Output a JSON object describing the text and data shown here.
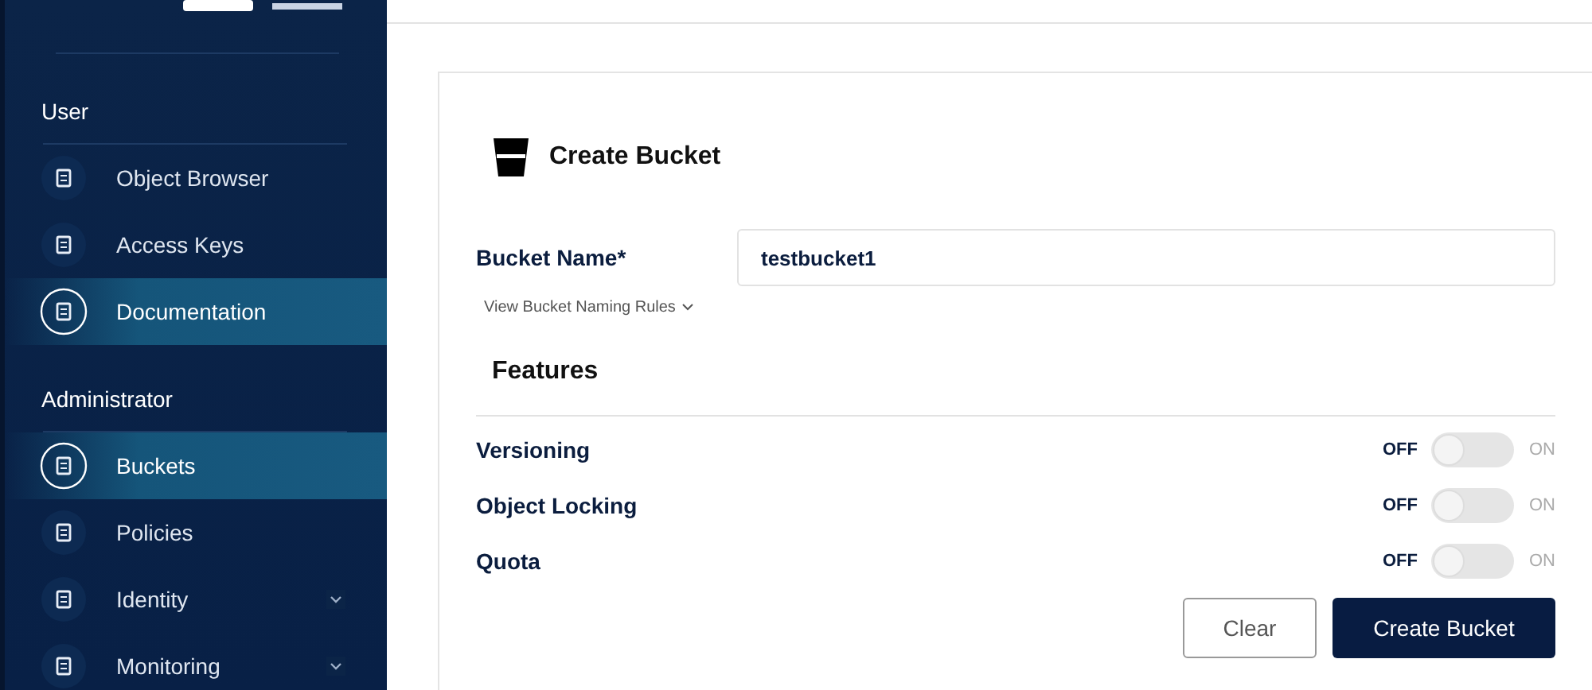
{
  "sidebar": {
    "sections": [
      {
        "title": "User",
        "items": [
          {
            "label": "Object Browser",
            "selected": false,
            "expandable": false
          },
          {
            "label": "Access Keys",
            "selected": false,
            "expandable": false
          },
          {
            "label": "Documentation",
            "selected": true,
            "expandable": false
          }
        ]
      },
      {
        "title": "Administrator",
        "items": [
          {
            "label": "Buckets",
            "selected": true,
            "expandable": false
          },
          {
            "label": "Policies",
            "selected": false,
            "expandable": false
          },
          {
            "label": "Identity",
            "selected": false,
            "expandable": true
          },
          {
            "label": "Monitoring",
            "selected": false,
            "expandable": true
          }
        ]
      }
    ]
  },
  "form": {
    "title": "Create Bucket",
    "name_label": "Bucket Name*",
    "name_value": "testbucket1",
    "rules_link": "View Bucket Naming Rules",
    "features_title": "Features",
    "features": [
      {
        "label": "Versioning",
        "on": false,
        "off_text": "OFF",
        "on_text": "ON"
      },
      {
        "label": "Object Locking",
        "on": false,
        "off_text": "OFF",
        "on_text": "ON"
      },
      {
        "label": "Quota",
        "on": false,
        "off_text": "OFF",
        "on_text": "ON"
      }
    ],
    "buttons": [
      "Clear",
      "Create Bucket"
    ]
  }
}
